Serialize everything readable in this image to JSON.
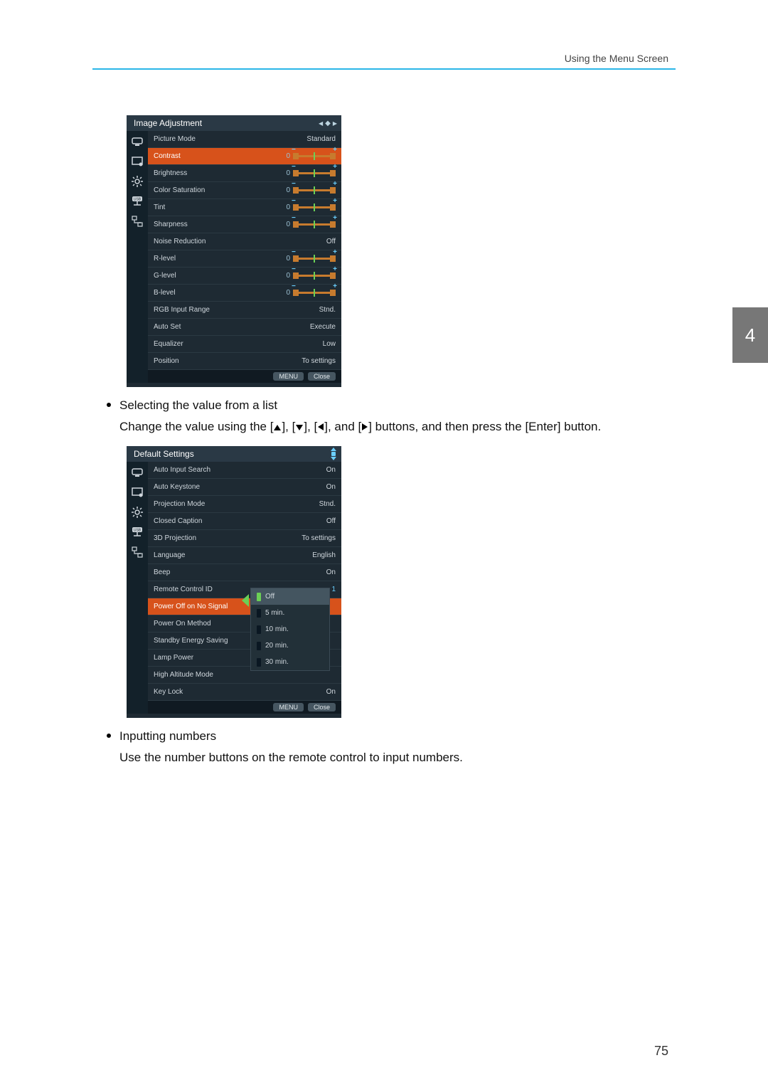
{
  "header": {
    "section": "Using the Menu Screen"
  },
  "page_number": "75",
  "chapter_tab": "4",
  "text": {
    "bullet1": "Selecting the value from a list",
    "line1_pre": "Change the value using the [",
    "line1_mid1": "], [",
    "line1_mid2": "], [",
    "line1_mid3": "], and [",
    "line1_post": "] buttons, and then press the [Enter] button.",
    "bullet2": "Inputting numbers",
    "line2": "Use the number buttons on the remote control to input numbers."
  },
  "menu1": {
    "title": "Image Adjustment",
    "rows": [
      {
        "label": "Picture Mode",
        "type": "value",
        "value": "Standard"
      },
      {
        "label": "Contrast",
        "type": "slider",
        "value": "0",
        "selected": true
      },
      {
        "label": "Brightness",
        "type": "slider",
        "value": "0"
      },
      {
        "label": "Color Saturation",
        "type": "slider",
        "value": "0"
      },
      {
        "label": "Tint",
        "type": "slider",
        "value": "0"
      },
      {
        "label": "Sharpness",
        "type": "slider",
        "value": "0"
      },
      {
        "label": "Noise Reduction",
        "type": "value",
        "value": "Off"
      },
      {
        "label": "R-level",
        "type": "slider",
        "value": "0"
      },
      {
        "label": "G-level",
        "type": "slider",
        "value": "0"
      },
      {
        "label": "B-level",
        "type": "slider",
        "value": "0"
      },
      {
        "label": "RGB Input Range",
        "type": "value",
        "value": "Stnd."
      },
      {
        "label": "Auto Set",
        "type": "value",
        "value": "Execute"
      },
      {
        "label": "Equalizer",
        "type": "value",
        "value": "Low"
      },
      {
        "label": "Position",
        "type": "value",
        "value": "To settings"
      }
    ],
    "footer": {
      "left": "MENU",
      "right": "Close"
    }
  },
  "menu2": {
    "title": "Default Settings",
    "rows": [
      {
        "label": "Auto Input Search",
        "type": "value",
        "value": "On"
      },
      {
        "label": "Auto Keystone",
        "type": "value",
        "value": "On"
      },
      {
        "label": "Projection Mode",
        "type": "value",
        "value": "Stnd."
      },
      {
        "label": "Closed Caption",
        "type": "value",
        "value": "Off"
      },
      {
        "label": "3D Projection",
        "type": "value",
        "value": "To settings"
      },
      {
        "label": "Language",
        "type": "value",
        "value": "English"
      },
      {
        "label": "Beep",
        "type": "value",
        "value": "On"
      },
      {
        "label": "Remote Control ID",
        "type": "value",
        "value": "1"
      },
      {
        "label": "Power Off on No Signal",
        "type": "dropdown",
        "selected": true
      },
      {
        "label": "Power On Method",
        "type": "empty"
      },
      {
        "label": "Standby Energy Saving",
        "type": "empty"
      },
      {
        "label": "Lamp Power",
        "type": "empty"
      },
      {
        "label": "High Altitude Mode",
        "type": "empty"
      },
      {
        "label": "Key Lock",
        "type": "value",
        "value": "On"
      }
    ],
    "dropdown": {
      "items": [
        {
          "label": "Off",
          "current": true
        },
        {
          "label": "5 min."
        },
        {
          "label": "10 min."
        },
        {
          "label": "20 min."
        },
        {
          "label": "30 min."
        }
      ]
    },
    "footer": {
      "left": "MENU",
      "right": "Close"
    }
  }
}
